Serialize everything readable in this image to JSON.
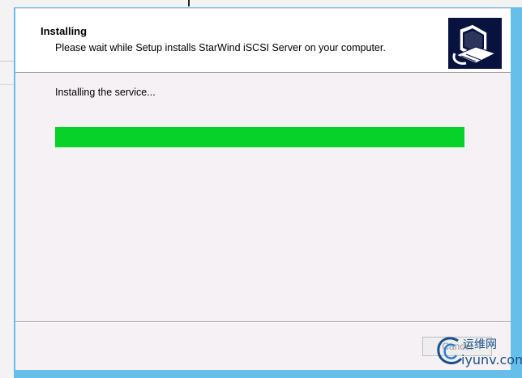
{
  "header": {
    "title": "Installing",
    "subtitle": "Please wait while Setup installs StarWind iSCSI Server on your computer."
  },
  "status": {
    "text": "Installing the service..."
  },
  "progress": {
    "fraction": 1.0,
    "color": "#06d22a"
  },
  "buttons": {
    "cancel_label": "Cancel"
  },
  "watermark": {
    "line1": "运维网",
    "line2": "iyunv.com"
  },
  "colors": {
    "frame": "#65bfe9",
    "logo_bg": "#08123f"
  },
  "icons": {
    "header_logo": "computer-install-icon",
    "watermark": "swirl-logo-icon"
  }
}
